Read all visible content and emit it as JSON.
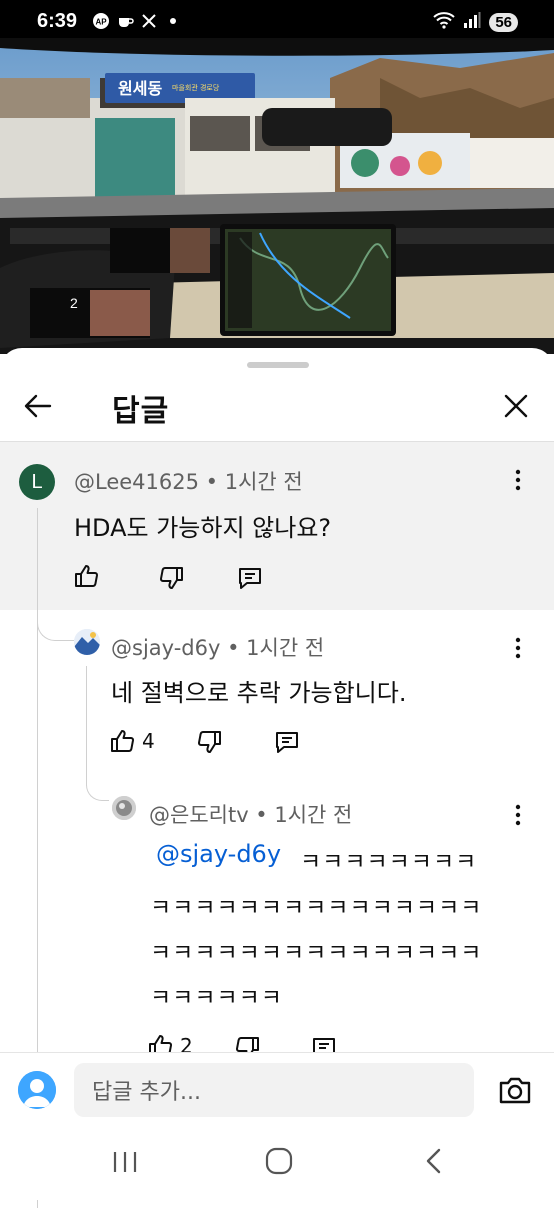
{
  "status_bar": {
    "time": "6:39",
    "battery": "56",
    "left_icons": [
      "app-badge-icon",
      "coffee-icon",
      "x-icon",
      "dot-icon"
    ],
    "right_icons": [
      "wifi-icon",
      "signal-icon"
    ]
  },
  "video": {
    "sign_text": "원세동",
    "sign_sub": "마을회관 경로당"
  },
  "header": {
    "title": "답글"
  },
  "comments": [
    {
      "author": "@Lee41625",
      "time": "1시간 전",
      "avatar_letter": "L",
      "text": "HDA도 가능하지 않나요?",
      "likes": ""
    },
    {
      "author": "@sjay-d6y",
      "time": "1시간 전",
      "text": "네 절벽으로 추락 가능합니다.",
      "likes": "4"
    },
    {
      "author": "@은도리tv",
      "time": "1시간 전",
      "mention": "@sjay-d6y",
      "text_line1": "ㅋㅋㅋㅋㅋㅋㅋㅋ",
      "text_line2": "ㅋㅋㅋㅋㅋㅋㅋㅋㅋㅋㅋㅋㅋㅋㅋ",
      "text_line3": "ㅋㅋㅋㅋㅋㅋㅋㅋㅋㅋㅋㅋㅋㅋㅋ",
      "text_line4": "ㅋㅋㅋㅋㅋㅋ",
      "likes": "2"
    }
  ],
  "composer": {
    "placeholder": "답글 추가..."
  },
  "separator": " • "
}
